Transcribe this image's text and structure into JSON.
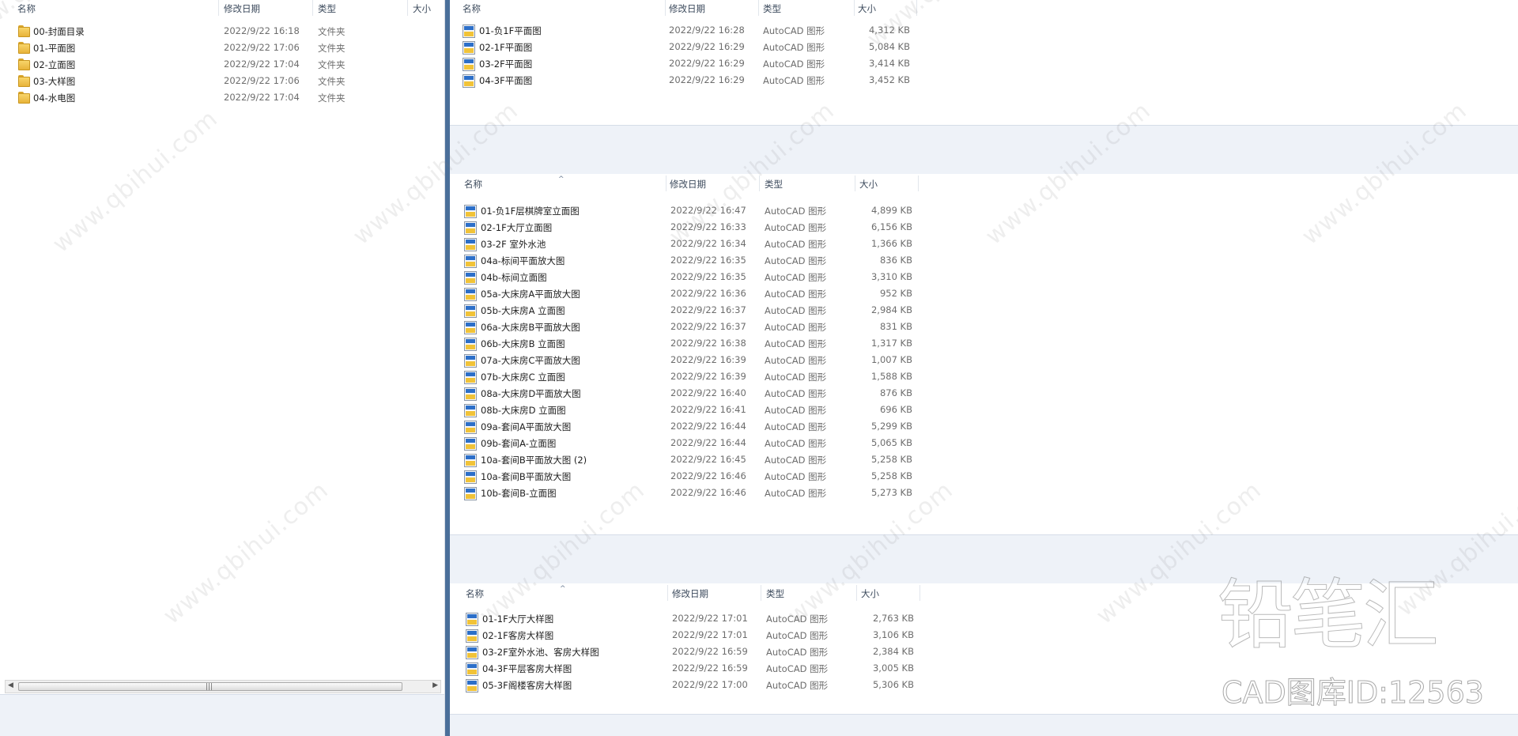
{
  "columns": {
    "name": "名称",
    "date": "修改日期",
    "type": "类型",
    "size": "大小"
  },
  "left_pane": {
    "rows": [
      {
        "name": "00-封面目录",
        "date": "2022/9/22 16:18",
        "type": "文件夹"
      },
      {
        "name": "01-平面图",
        "date": "2022/9/22 17:06",
        "type": "文件夹"
      },
      {
        "name": "02-立面图",
        "date": "2022/9/22 17:04",
        "type": "文件夹"
      },
      {
        "name": "03-大样图",
        "date": "2022/9/22 17:06",
        "type": "文件夹"
      },
      {
        "name": "04-水电图",
        "date": "2022/9/22 17:04",
        "type": "文件夹"
      }
    ],
    "scroll_grip": "|||"
  },
  "pane1": {
    "rows": [
      {
        "name": "01-负1F平面图",
        "date": "2022/9/22 16:28",
        "type": "AutoCAD 图形",
        "size": "4,312 KB"
      },
      {
        "name": "02-1F平面图",
        "date": "2022/9/22 16:29",
        "type": "AutoCAD 图形",
        "size": "5,084 KB"
      },
      {
        "name": "03-2F平面图",
        "date": "2022/9/22 16:29",
        "type": "AutoCAD 图形",
        "size": "3,414 KB"
      },
      {
        "name": "04-3F平面图",
        "date": "2022/9/22 16:29",
        "type": "AutoCAD 图形",
        "size": "3,452 KB"
      }
    ]
  },
  "pane2": {
    "rows": [
      {
        "name": "01-负1F层棋牌室立面图",
        "date": "2022/9/22 16:47",
        "type": "AutoCAD 图形",
        "size": "4,899 KB"
      },
      {
        "name": "02-1F大厅立面图",
        "date": "2022/9/22 16:33",
        "type": "AutoCAD 图形",
        "size": "6,156 KB"
      },
      {
        "name": "03-2F 室外水池",
        "date": "2022/9/22 16:34",
        "type": "AutoCAD 图形",
        "size": "1,366 KB"
      },
      {
        "name": "04a-标间平面放大图",
        "date": "2022/9/22 16:35",
        "type": "AutoCAD 图形",
        "size": "836 KB"
      },
      {
        "name": "04b-标间立面图",
        "date": "2022/9/22 16:35",
        "type": "AutoCAD 图形",
        "size": "3,310 KB"
      },
      {
        "name": "05a-大床房A平面放大图",
        "date": "2022/9/22 16:36",
        "type": "AutoCAD 图形",
        "size": "952 KB"
      },
      {
        "name": "05b-大床房A 立面图",
        "date": "2022/9/22 16:37",
        "type": "AutoCAD 图形",
        "size": "2,984 KB"
      },
      {
        "name": "06a-大床房B平面放大图",
        "date": "2022/9/22 16:37",
        "type": "AutoCAD 图形",
        "size": "831 KB"
      },
      {
        "name": "06b-大床房B 立面图",
        "date": "2022/9/22 16:38",
        "type": "AutoCAD 图形",
        "size": "1,317 KB"
      },
      {
        "name": "07a-大床房C平面放大图",
        "date": "2022/9/22 16:39",
        "type": "AutoCAD 图形",
        "size": "1,007 KB"
      },
      {
        "name": "07b-大床房C 立面图",
        "date": "2022/9/22 16:39",
        "type": "AutoCAD 图形",
        "size": "1,588 KB"
      },
      {
        "name": "08a-大床房D平面放大图",
        "date": "2022/9/22 16:40",
        "type": "AutoCAD 图形",
        "size": "876 KB"
      },
      {
        "name": "08b-大床房D 立面图",
        "date": "2022/9/22 16:41",
        "type": "AutoCAD 图形",
        "size": "696 KB"
      },
      {
        "name": "09a-套间A平面放大图",
        "date": "2022/9/22 16:44",
        "type": "AutoCAD 图形",
        "size": "5,299 KB"
      },
      {
        "name": "09b-套间A-立面图",
        "date": "2022/9/22 16:44",
        "type": "AutoCAD 图形",
        "size": "5,065 KB"
      },
      {
        "name": "10a-套间B平面放大图 (2)",
        "date": "2022/9/22 16:45",
        "type": "AutoCAD 图形",
        "size": "5,258 KB"
      },
      {
        "name": "10a-套间B平面放大图",
        "date": "2022/9/22 16:46",
        "type": "AutoCAD 图形",
        "size": "5,258 KB"
      },
      {
        "name": "10b-套间B-立面图",
        "date": "2022/9/22 16:46",
        "type": "AutoCAD 图形",
        "size": "5,273 KB"
      }
    ]
  },
  "pane3": {
    "rows": [
      {
        "name": "01-1F大厅大样图",
        "date": "2022/9/22 17:01",
        "type": "AutoCAD 图形",
        "size": "2,763 KB"
      },
      {
        "name": "02-1F客房大样图",
        "date": "2022/9/22 17:01",
        "type": "AutoCAD 图形",
        "size": "3,106 KB"
      },
      {
        "name": "03-2F室外水池、客房大样图",
        "date": "2022/9/22 16:59",
        "type": "AutoCAD 图形",
        "size": "2,384 KB"
      },
      {
        "name": "04-3F平层客房大样图",
        "date": "2022/9/22 16:59",
        "type": "AutoCAD 图形",
        "size": "3,005 KB"
      },
      {
        "name": "05-3F阁楼客房大样图",
        "date": "2022/9/22 17:00",
        "type": "AutoCAD 图形",
        "size": "5,306 KB"
      }
    ]
  },
  "watermark": {
    "site": "www.qbihui.com",
    "logo": "铅笔汇",
    "cad_id": "CAD图库ID:12563"
  },
  "icons": {
    "folder": "folder-icon",
    "dwg": "autocad-file-icon"
  }
}
